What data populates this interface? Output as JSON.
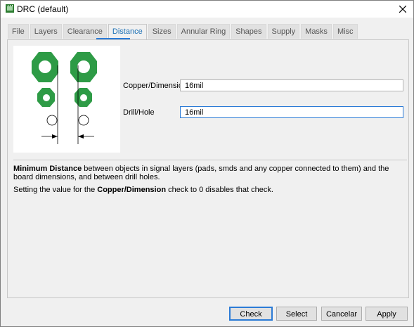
{
  "window": {
    "title": "DRC (default)"
  },
  "tabs": [
    {
      "label": "File"
    },
    {
      "label": "Layers"
    },
    {
      "label": "Clearance"
    },
    {
      "label": "Distance"
    },
    {
      "label": "Sizes"
    },
    {
      "label": "Annular Ring"
    },
    {
      "label": "Shapes"
    },
    {
      "label": "Supply"
    },
    {
      "label": "Masks"
    },
    {
      "label": "Misc"
    }
  ],
  "active_tab": "Distance",
  "fields": {
    "copper_dimension": {
      "label": "Copper/Dimension",
      "value": "16mil"
    },
    "drill_hole": {
      "label": "Drill/Hole",
      "value": "16mil"
    }
  },
  "description": {
    "bold1": "Minimum Distance",
    "text1": " between objects in signal layers (pads, smds and any copper connected to them) and the board dimensions, and between drill holes.",
    "text2a": "Setting the value for the ",
    "bold2": "Copper/Dimension",
    "text2b": " check to 0 disables that check."
  },
  "buttons": {
    "check": "Check",
    "select": "Select",
    "cancel": "Cancelar",
    "apply": "Apply"
  },
  "colors": {
    "pad_green": "#2e9b46",
    "accent": "#2b7bd6"
  },
  "icons": {
    "close": "close-icon",
    "app": "app-icon"
  }
}
